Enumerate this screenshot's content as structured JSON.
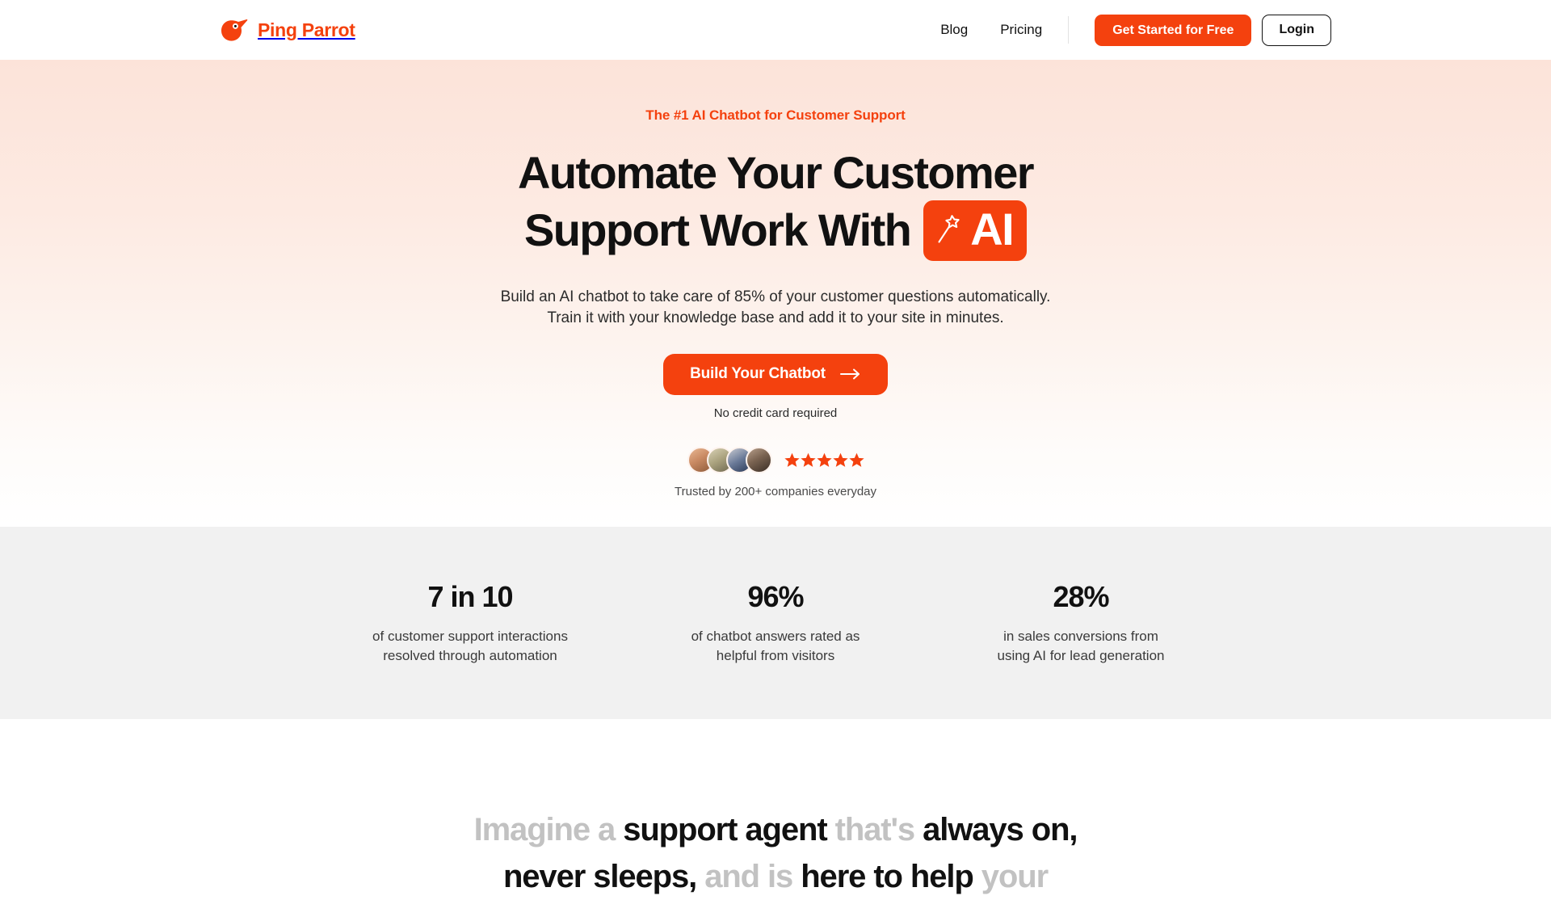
{
  "brand": {
    "name": "Ping Parrot",
    "logo_icon": "parrot-icon",
    "accent_color": "#F4410E",
    "hero_bg_top": "#FCE3D9",
    "stats_bg": "#F1F1F1"
  },
  "header": {
    "nav_links": [
      {
        "label": "Blog"
      },
      {
        "label": "Pricing"
      }
    ],
    "primary_button": "Get Started for Free",
    "secondary_button": "Login"
  },
  "hero": {
    "eyebrow": "The #1 AI Chatbot for Customer Support",
    "title_line_1": "Automate Your Customer",
    "title_line_2": "Support Work With",
    "title_badge": "AI",
    "badge_icon": "magic-wand-icon",
    "subtitle_line_1": "Build an AI chatbot to take care of 85% of your customer questions automatically.",
    "subtitle_line_2": "Train it with your knowledge base and add it to your site in minutes.",
    "cta_label": "Build Your Chatbot",
    "cta_icon": "arrow-right-icon",
    "no_credit_card": "No credit card required",
    "avatar_count": 4,
    "star_count": 5,
    "star_icon": "star-icon",
    "star_color": "#F4410E",
    "trusted_text": "Trusted by 200+ companies everyday"
  },
  "stats": [
    {
      "value": "7 in 10",
      "label_line_1": "of customer support interactions",
      "label_line_2": "resolved through automation"
    },
    {
      "value": "96%",
      "label_line_1": "of chatbot answers rated as",
      "label_line_2": "helpful from visitors"
    },
    {
      "value": "28%",
      "label_line_1": "in sales conversions from",
      "label_line_2": "using AI for lead generation"
    }
  ],
  "imagine": {
    "words": [
      {
        "text": "Imagine",
        "tone": "light"
      },
      {
        "text": "a",
        "tone": "light"
      },
      {
        "text": "support",
        "tone": "dark"
      },
      {
        "text": "agent",
        "tone": "dark"
      },
      {
        "text": "that's",
        "tone": "light"
      },
      {
        "text": "always",
        "tone": "dark"
      },
      {
        "text": "on,",
        "tone": "dark"
      },
      {
        "text": "never",
        "tone": "dark"
      },
      {
        "text": "sleeps,",
        "tone": "dark"
      },
      {
        "text": "and",
        "tone": "light"
      },
      {
        "text": "is",
        "tone": "light"
      },
      {
        "text": "here",
        "tone": "dark"
      },
      {
        "text": "to",
        "tone": "dark"
      },
      {
        "text": "help",
        "tone": "dark"
      },
      {
        "text": "your",
        "tone": "light"
      }
    ],
    "full_text": "Imagine a support agent that's always on, never sleeps, and is here to help your"
  }
}
